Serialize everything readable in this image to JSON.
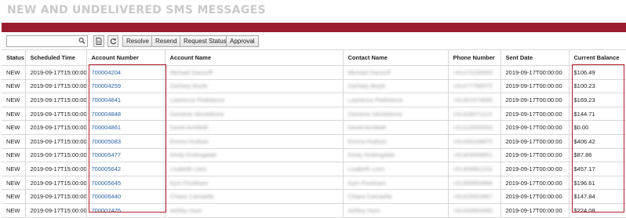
{
  "page_title": "NEW AND UNDELIVERED SMS MESSAGES",
  "toolbar": {
    "search_placeholder": "",
    "buttons": [
      "Resolve",
      "Resend",
      "Request Status",
      "Approval"
    ]
  },
  "columns": [
    "Status",
    "Scheduled Time",
    "Account Number",
    "Account Name",
    "Contact Name",
    "Phone Number",
    "Sent Date",
    "Current Balance"
  ],
  "rows": [
    {
      "status": "NEW",
      "scheduled": "2019-09-17T15:00:00",
      "account": "700004204",
      "name": "Michael Danouff",
      "contact": "Michael Danouff",
      "phone": "+61470156565",
      "sent": "2019-09-17T00:00:00",
      "balance": "$106.49"
    },
    {
      "status": "NEW",
      "scheduled": "2019-09-17T15:00:00",
      "account": "700004259",
      "name": "Zachary Boyle",
      "contact": "Zachary Boyle",
      "phone": "+61477766075",
      "sent": "2019-09-17T00:00:00",
      "balance": "$100.23"
    },
    {
      "status": "NEW",
      "scheduled": "2019-09-17T15:00:00",
      "account": "700004841",
      "name": "Lawrence Pedelance",
      "contact": "Lawrence Pedelance",
      "phone": "+61401574685",
      "sent": "2019-09-17T00:00:00",
      "balance": "$169.23"
    },
    {
      "status": "NEW",
      "scheduled": "2019-09-17T15:00:00",
      "account": "700004848",
      "name": "Domenic Montebone",
      "contact": "Domenic Montebone",
      "phone": "+61428071113",
      "sent": "2019-09-17T00:00:00",
      "balance": "$144.71"
    },
    {
      "status": "NEW",
      "scheduled": "2019-09-17T15:00:00",
      "account": "700004861",
      "name": "David Armfield",
      "contact": "David Armfield",
      "phone": "+61416555555",
      "sent": "2019-09-17T00:00:00",
      "balance": "$0.00"
    },
    {
      "status": "NEW",
      "scheduled": "2019-09-17T15:00:00",
      "account": "700005083",
      "name": "Emma Hudson",
      "contact": "Emma Hudson",
      "phone": "+61430168970",
      "sent": "2019-09-17T00:00:00",
      "balance": "$406.42"
    },
    {
      "status": "NEW",
      "scheduled": "2019-09-17T15:00:00",
      "account": "700005477",
      "name": "Kirsty Kinkingdale",
      "contact": "Kirsty Kinkingdale",
      "phone": "+61403099951",
      "sent": "2019-09-17T00:00:00",
      "balance": "$87.86"
    },
    {
      "status": "NEW",
      "scheduled": "2019-09-17T15:00:00",
      "account": "700005642",
      "name": "Lisabeth Lees",
      "contact": "Lisabeth Lees",
      "phone": "+61409951103",
      "sent": "2019-09-17T00:00:00",
      "balance": "$457.17"
    },
    {
      "status": "NEW",
      "scheduled": "2019-09-17T15:00:00",
      "account": "700005645",
      "name": "Kym Peckham",
      "contact": "Kym Peckham",
      "phone": "+61400554886",
      "sent": "2019-09-17T00:00:00",
      "balance": "$196.61"
    },
    {
      "status": "NEW",
      "scheduled": "2019-09-17T15:00:00",
      "account": "700006440",
      "name": "Chiara Camaella",
      "contact": "Chiara Camaella",
      "phone": "+61425003987",
      "sent": "2019-09-17T00:00:00",
      "balance": "$147.84"
    },
    {
      "status": "NEW",
      "scheduled": "2019-09-17T15:00:00",
      "account": "700007476",
      "name": "Ashley Hunt",
      "contact": "Ashley Hunt",
      "phone": "+61433664480",
      "sent": "2019-09-17T00:00:00",
      "balance": "$224.08"
    }
  ],
  "colors": {
    "accent_bar": "#9b1c2e",
    "link": "#2a64a8",
    "highlight_box": "#b3202a"
  }
}
